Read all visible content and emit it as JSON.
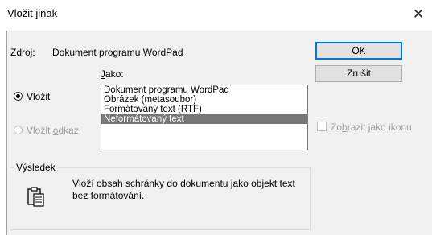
{
  "dialog": {
    "title": "Vložit jinak",
    "close_glyph": "✕"
  },
  "source": {
    "label": "Zdroj:",
    "value": "Dokument programu WordPad"
  },
  "as_label_prefix": "J",
  "as_label_rest": "ako:",
  "list": {
    "items": [
      "Dokument programu WordPad",
      "Obrázek (metasoubor)",
      "Formátovaný text (RTF)",
      "Neformátovaný text"
    ],
    "selected_index": 3
  },
  "radio_paste": {
    "prefix": "",
    "ul": "V",
    "rest": "ložit",
    "checked": true
  },
  "radio_paste_link": {
    "prefix": "Vložit ",
    "ul": "o",
    "rest": "dkaz",
    "checked": false
  },
  "buttons": {
    "ok": "OK",
    "cancel": "Zrušit"
  },
  "show_as_icon": {
    "prefix": "Zo",
    "ul": "b",
    "rest": "razit jako ikonu",
    "checked": false
  },
  "result": {
    "title": "Výsledek",
    "text_line1": "Vloží obsah schránky do dokumentu jako objekt text",
    "text_line2": "bez formátování.",
    "icon": "clipboard-paste-icon"
  }
}
